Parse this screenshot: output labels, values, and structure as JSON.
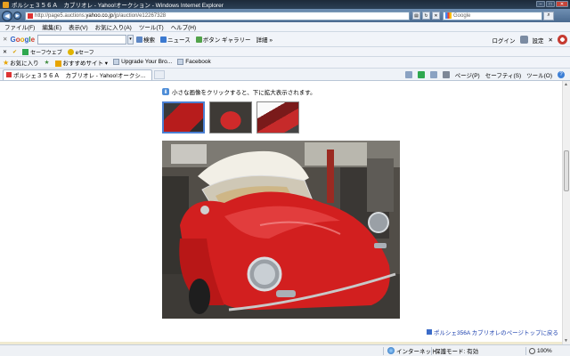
{
  "window": {
    "title": "ポルシェ３５６Ａ　カブリオレ - Yahoo!オークション - Windows Internet Explorer"
  },
  "address": {
    "url_prefix": "http://page5.auctions.",
    "url_domain": "yahoo.co.jp",
    "url_suffix": "/jp/auction/e12267328",
    "search_placeholder": "Google"
  },
  "menu": [
    "ファイル(F)",
    "編集(E)",
    "表示(V)",
    "お気に入り(A)",
    "ツール(T)",
    "ヘルプ(H)"
  ],
  "google_toolbar": {
    "search_label": "検索",
    "news_label": "ニュース",
    "button_gallery_label": "ボタン ギャラリー",
    "more_label": "詳細 »",
    "login_label": "ログイン",
    "settings_label": "設定"
  },
  "sub_toolbar": {
    "safeweb_label": "セーフウェブ",
    "esafe_label": "eセーフ"
  },
  "favorites_bar": {
    "favorites_label": "お気に入り",
    "suggested_sites_label": "おすすめサイト",
    "upgrade_label": "Upgrade Your Bro...",
    "facebook_label": "Facebook"
  },
  "tab": {
    "title": "ポルシェ３５６Ａ　カブリオレ - Yahoo!オークシ..."
  },
  "command_bar": {
    "page_label": "ページ(P)",
    "safety_label": "セーフティ(S)",
    "tools_label": "ツール(O)"
  },
  "content": {
    "instruction": "小さな画像をクリックすると、下に拡大表示されます。",
    "page_top_link": "ポルシェ356A カブリオレのページトップに戻る"
  },
  "statusbar": {
    "zone": "インターネット",
    "protected_mode": "保護モード: 有効",
    "zoom": "100%"
  }
}
